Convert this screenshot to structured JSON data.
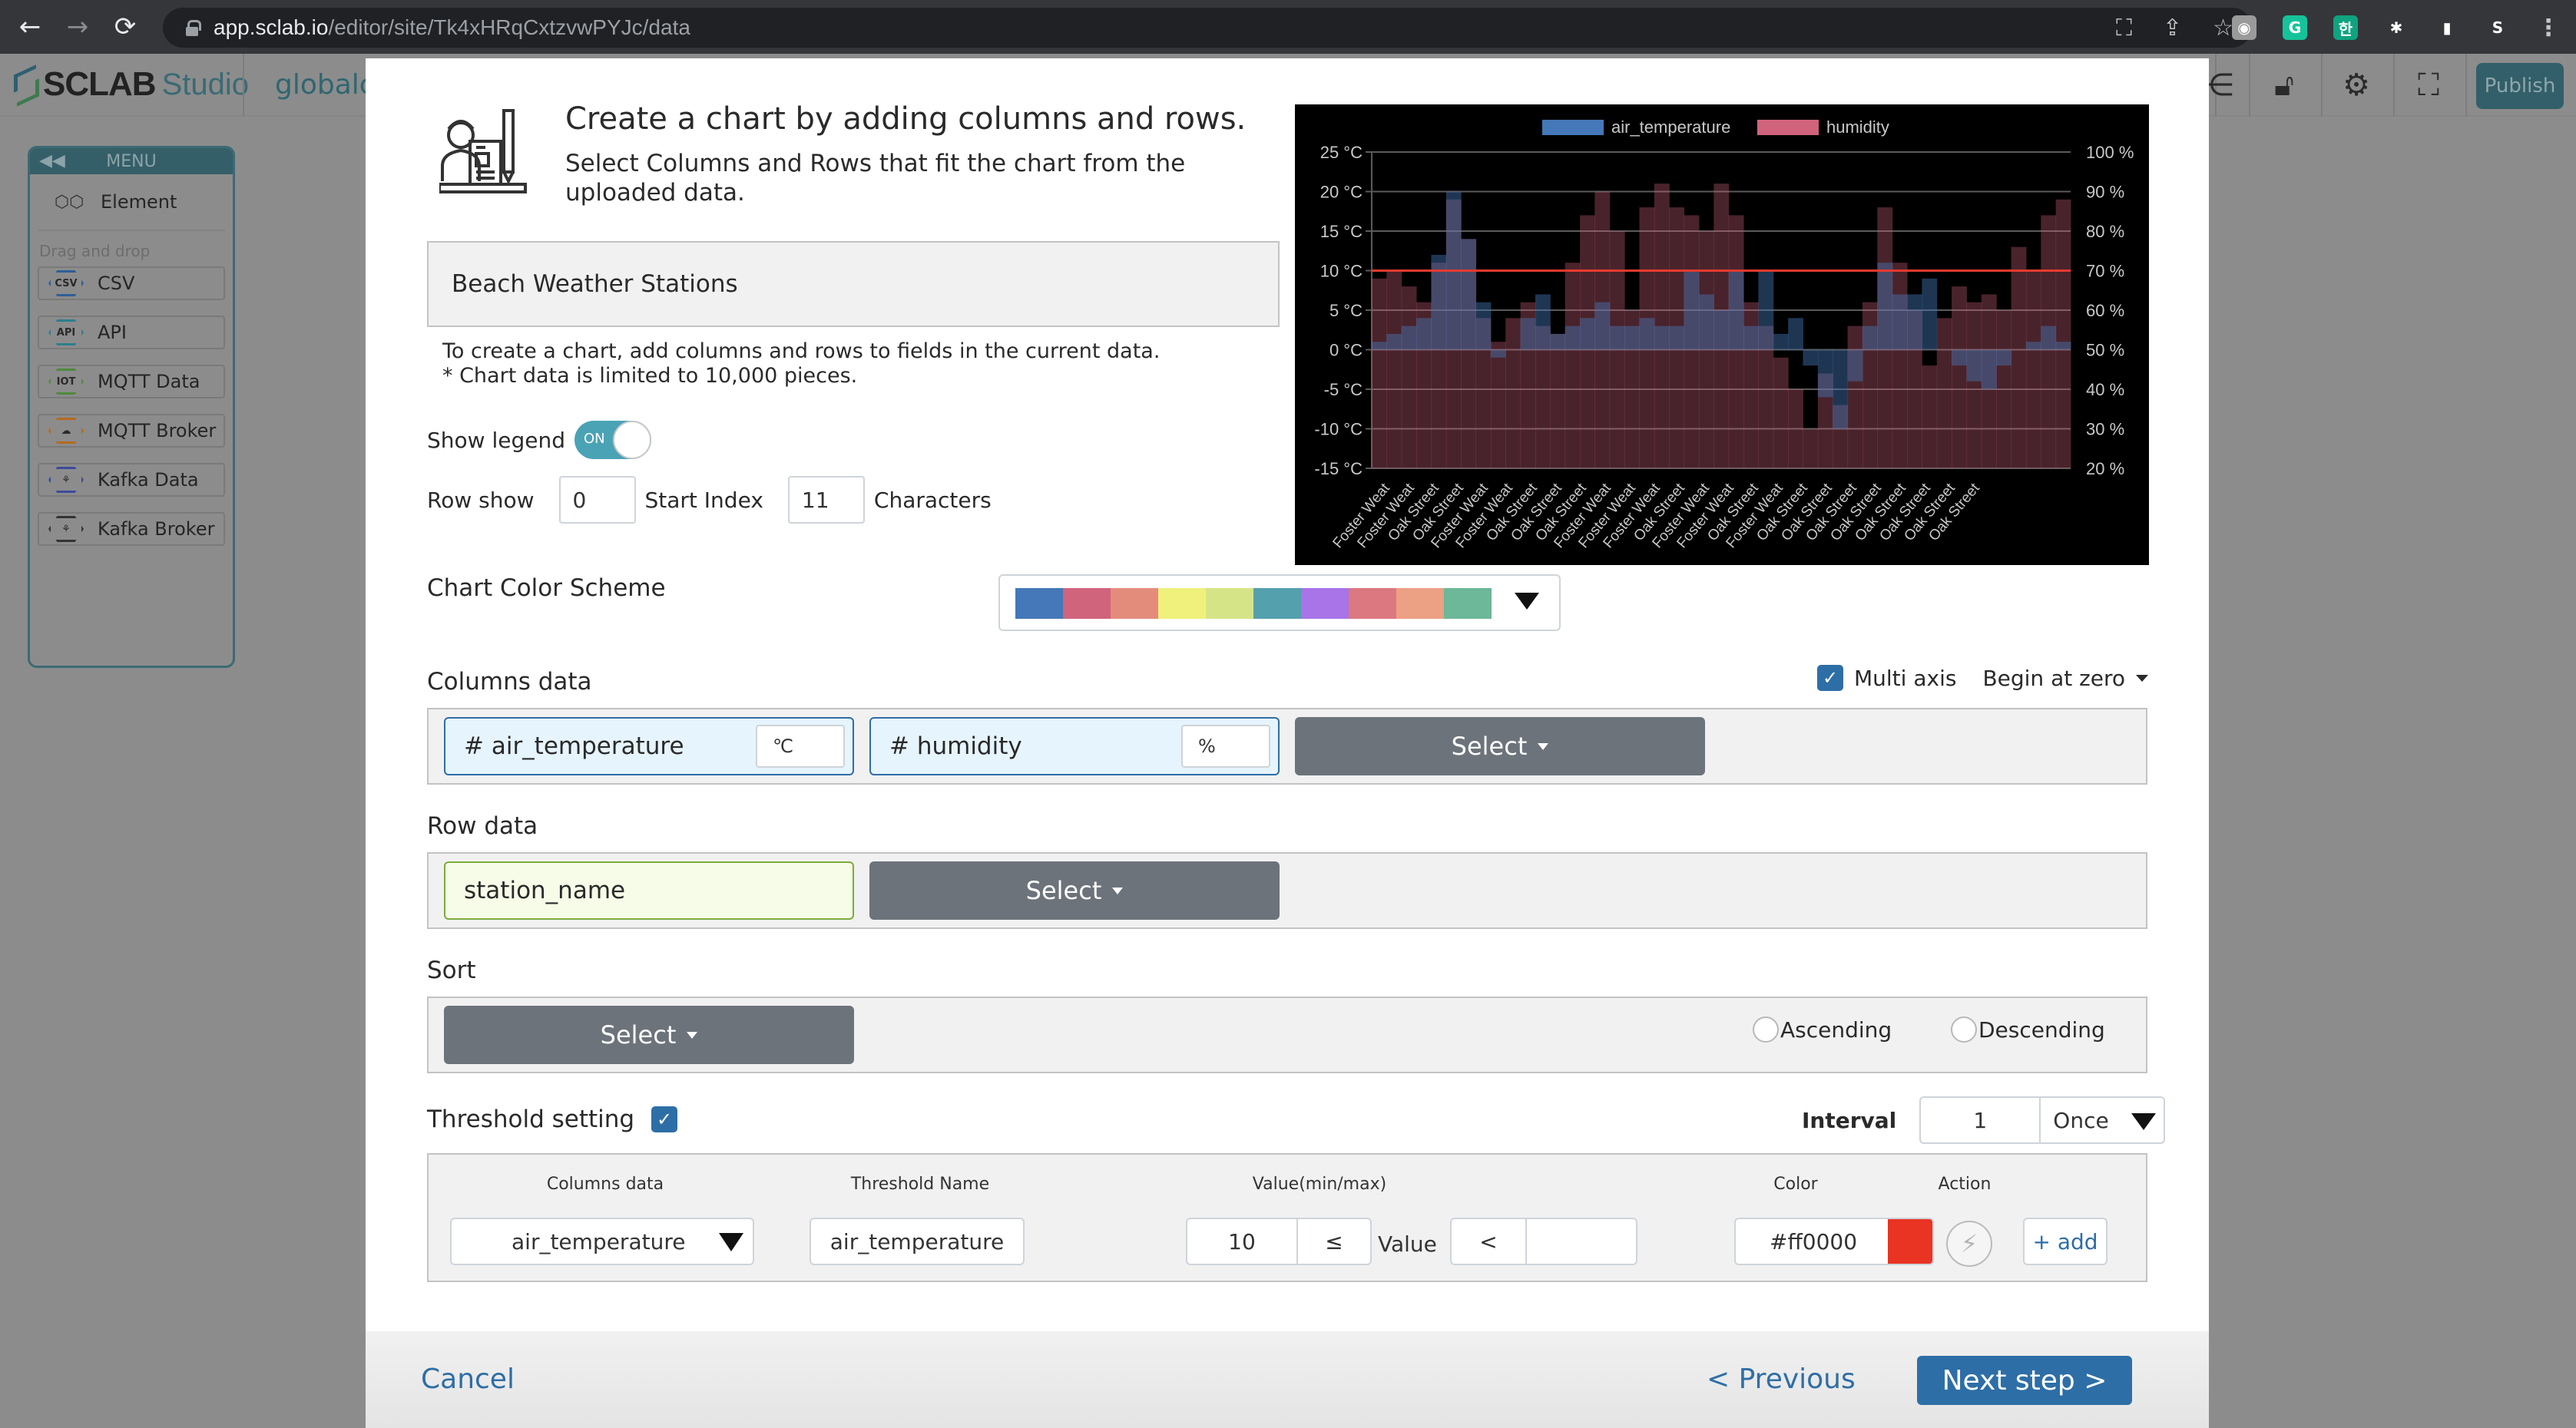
{
  "browser": {
    "url_host": "app.sclab.io",
    "url_path": "/editor/site/Tk4xHRqCxtzvwPYJc/data",
    "nav": {
      "back": "←",
      "forward": "→",
      "reload": "⟳"
    },
    "omni_icons": [
      "translate-icon",
      "share-icon",
      "star-icon"
    ],
    "extensions": [
      {
        "name": "camera-extension-icon",
        "glyph": "◉",
        "color": "#9a9a9a"
      },
      {
        "name": "grammarly-extension-icon",
        "glyph": "G",
        "color": "#15c39a"
      },
      {
        "name": "translate-ko-extension-icon",
        "glyph": "한",
        "color": "#10a37f"
      },
      {
        "name": "puzzle-extensions-icon",
        "glyph": "✱",
        "color": "#35363a"
      },
      {
        "name": "sidepanel-icon",
        "glyph": "▮",
        "color": "#35363a"
      },
      {
        "name": "sclab-extension-icon",
        "glyph": "S",
        "color": "#35363a"
      }
    ],
    "menu_glyph": "⋮"
  },
  "app": {
    "logo_text": "SCLAB",
    "logo_sub": "Studio",
    "project_name": "globalc",
    "publish_label": "Publish",
    "header_icons": [
      "share-icon",
      "unlock-icon",
      "settings-icon",
      "fullscreen-icon"
    ]
  },
  "menu": {
    "title": "MENU",
    "collapse_glyph": "◀◀",
    "element_label": "Element",
    "dnd_label": "Drag and drop",
    "items": [
      {
        "label": "CSV",
        "badge": "CSV",
        "color": "#2e5f96"
      },
      {
        "label": "API",
        "badge": "API",
        "color": "#2d7f8c"
      },
      {
        "label": "MQTT Data",
        "badge": "IOT",
        "color": "#4f8a3d"
      },
      {
        "label": "MQTT Broker",
        "badge": "☁",
        "color": "#b56a1e"
      },
      {
        "label": "Kafka Data",
        "badge": "⚘",
        "color": "#3d4a9a"
      },
      {
        "label": "Kafka Broker",
        "badge": "⚘",
        "color": "#333333"
      }
    ]
  },
  "modal": {
    "title": "Create a chart by adding columns and rows.",
    "subtitle": "Select Columns and Rows that fit the chart from the uploaded data.",
    "data_name": "Beach Weather Stations",
    "hint_line1": "To create a chart, add columns and rows to fields in the current data.",
    "hint_line2": "* Chart data is limited to 10,000 pieces.",
    "show_legend_label": "Show legend",
    "show_legend_state": "ON",
    "row_show_label": "Row show",
    "start_index_value": "0",
    "start_index_label": "Start Index",
    "characters_value": "11",
    "characters_label": "Characters",
    "color_scheme_label": "Chart Color Scheme",
    "color_scheme": [
      "#4478b8",
      "#d0647c",
      "#e48c7c",
      "#f0f07c",
      "#d6e488",
      "#54a0ac",
      "#a874e8",
      "#dc7880",
      "#eca084",
      "#6cb898"
    ],
    "columns_label": "Columns data",
    "multi_axis_label": "Multi axis",
    "multi_axis_checked": true,
    "begin_at_zero_label": "Begin at zero",
    "columns": [
      {
        "name": "# air_temperature",
        "unit": "℃"
      },
      {
        "name": "# humidity",
        "unit": "%"
      }
    ],
    "select_label": "Select",
    "row_label": "Row data",
    "row_value": "station_name",
    "sort_label": "Sort",
    "ascending_label": "Ascending",
    "descending_label": "Descending",
    "threshold_label": "Threshold setting",
    "threshold_checked": true,
    "interval_label": "Interval",
    "interval_value": "1",
    "interval_mode": "Once",
    "threshold_headers": {
      "columns_data": "Columns data",
      "threshold_name": "Threshold Name",
      "value": "Value(min/max)",
      "color": "Color",
      "action": "Action"
    },
    "threshold_row": {
      "column": "air_temperature",
      "name": "air_temperature",
      "min": "10",
      "min_op": "≤",
      "value_label": "Value",
      "max_op": "<",
      "max": "",
      "color": "#ff0000",
      "action_glyph": "⚡",
      "add_label": "+ add"
    },
    "cancel_label": "Cancel",
    "previous_label": "< Previous",
    "next_label": "Next step >"
  },
  "chart_data": {
    "type": "bar",
    "legend": [
      {
        "name": "air_temperature",
        "color": "#4478b8"
      },
      {
        "name": "humidity",
        "color": "#d0647c"
      }
    ],
    "legend_position": "top",
    "y_left": {
      "ticks": [
        "25 °C",
        "20 °C",
        "15 °C",
        "10 °C",
        "5 °C",
        "0 °C",
        "-5 °C",
        "-10 °C",
        "-15 °C"
      ],
      "range": [
        -15,
        25
      ]
    },
    "y_right": {
      "ticks": [
        "100 %",
        "90 %",
        "80 %",
        "70 %",
        "60 %",
        "50 %",
        "40 %",
        "30 %",
        "20 %"
      ],
      "range": [
        20,
        100
      ]
    },
    "threshold": {
      "series": "air_temperature",
      "value": 10,
      "color": "#ff0000"
    },
    "grid": true,
    "x_labels": [
      "Foster Weat",
      "Foster Weat",
      "Oak Street",
      "Oak Street",
      "Foster Weat",
      "Foster Weat",
      "Oak Street",
      "Oak Street",
      "Oak Street",
      "Foster Weat",
      "Foster Weat",
      "Foster Weat",
      "Oak Street",
      "Foster Weat",
      "Foster Weat",
      "Oak Street",
      "Foster Weat",
      "Oak Street",
      "Oak Street",
      "Oak Street",
      "Oak Street",
      "Oak Street",
      "Oak Street",
      "Oak Street",
      "Oak Street"
    ],
    "series": [
      {
        "name": "air_temperature",
        "unit": "°C",
        "values": [
          1,
          2,
          3,
          4,
          12,
          20,
          14,
          6,
          -1,
          0,
          4,
          7,
          2,
          3,
          4,
          6,
          3,
          3,
          4,
          3,
          3,
          10,
          7,
          5,
          10,
          3,
          10,
          2,
          4,
          -2,
          -6,
          -10,
          -4,
          3,
          11,
          7,
          7,
          9,
          0,
          -2,
          -4,
          -5,
          -2,
          0,
          1,
          3,
          1
        ]
      },
      {
        "name": "humidity",
        "unit": "%",
        "values": [
          68,
          70,
          66,
          62,
          72,
          88,
          78,
          58,
          52,
          58,
          62,
          56,
          54,
          72,
          84,
          90,
          80,
          60,
          86,
          92,
          86,
          84,
          80,
          92,
          84,
          62,
          56,
          48,
          40,
          30,
          44,
          36,
          56,
          62,
          86,
          72,
          60,
          46,
          58,
          66,
          62,
          64,
          60,
          76,
          70,
          84,
          88
        ]
      }
    ]
  }
}
